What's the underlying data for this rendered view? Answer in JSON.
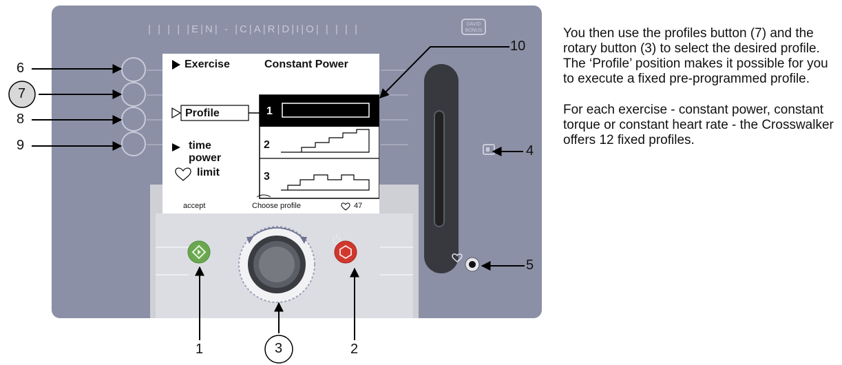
{
  "brand_text": "| | | | |E|N| - |C|A|R|D|I|O| | | | |",
  "logo_text": "DAVID BONUS",
  "screen": {
    "exercise_label": "Exercise",
    "mode_title": "Constant Power",
    "profile_label": "Profile",
    "menu_time": "time",
    "menu_power": "power",
    "menu_limit": "limit",
    "profile_numbers": [
      "1",
      "2",
      "3"
    ],
    "footer_accept": "accept",
    "footer_choose": "Choose profile",
    "footer_heart_value": "47"
  },
  "callouts": [
    "1",
    "2",
    "3",
    "4",
    "5",
    "6",
    "7",
    "8",
    "9",
    "10"
  ],
  "description": {
    "paragraph_1": "You then use the profiles button (7) and the rotary button (3) to select the desired profile. The ‘Profile’ position makes it possible for you to execute a fixed pre-programmed profile.",
    "paragraph_2": "For each exercise - constant power, constant torque or constant heart rate - the Crosswalker offers 12 fixed profiles."
  },
  "colors": {
    "panel": "#8c90a6",
    "start_button": "#6aa84f",
    "stop_button": "#d0372e"
  }
}
